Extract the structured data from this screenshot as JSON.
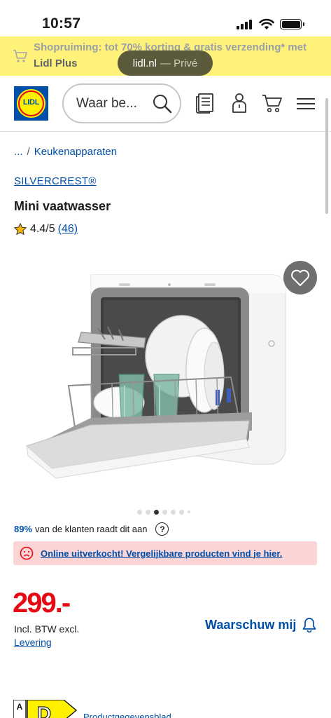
{
  "status_bar": {
    "time": "10:57"
  },
  "promo": {
    "line1": "Shopruiming: tot 70% korting & gratis verzending* met",
    "line2": "Lidl Plus",
    "background": "#fff27a"
  },
  "browser": {
    "url": "lidl.nl",
    "mode": "— Privé"
  },
  "header": {
    "logo_text": "LIDL",
    "search_placeholder": "Waar be...",
    "icons": [
      "brochure-icon",
      "account-icon",
      "cart-icon",
      "menu-icon"
    ]
  },
  "breadcrumb": {
    "ellipsis": "...",
    "separator": "/",
    "current": "Keukenapparaten"
  },
  "product": {
    "brand": "SILVERCREST®",
    "title": "Mini vaatwasser",
    "rating": "4.4/5",
    "review_count": "(46)",
    "image_count": 7,
    "active_image": 3
  },
  "recommend": {
    "percent": "89%",
    "text": "van de klanten raadt dit aan",
    "help": "?"
  },
  "soldout": {
    "text": "Online uitverkocht! Vergelijkbare producten vind je hier."
  },
  "pricing": {
    "price": "299.-",
    "vat_text": "Incl. BTW excl.",
    "delivery_link": "Levering",
    "notify_label": "Waarschuw mij"
  },
  "energy": {
    "label": "D",
    "scale_top": "A",
    "datasheet_link": "Productgegevensblad"
  },
  "colors": {
    "brand_blue": "#0050aa",
    "brand_red": "#e60a14",
    "brand_yellow": "#fff000",
    "alert_bg": "#fbd5d5"
  }
}
